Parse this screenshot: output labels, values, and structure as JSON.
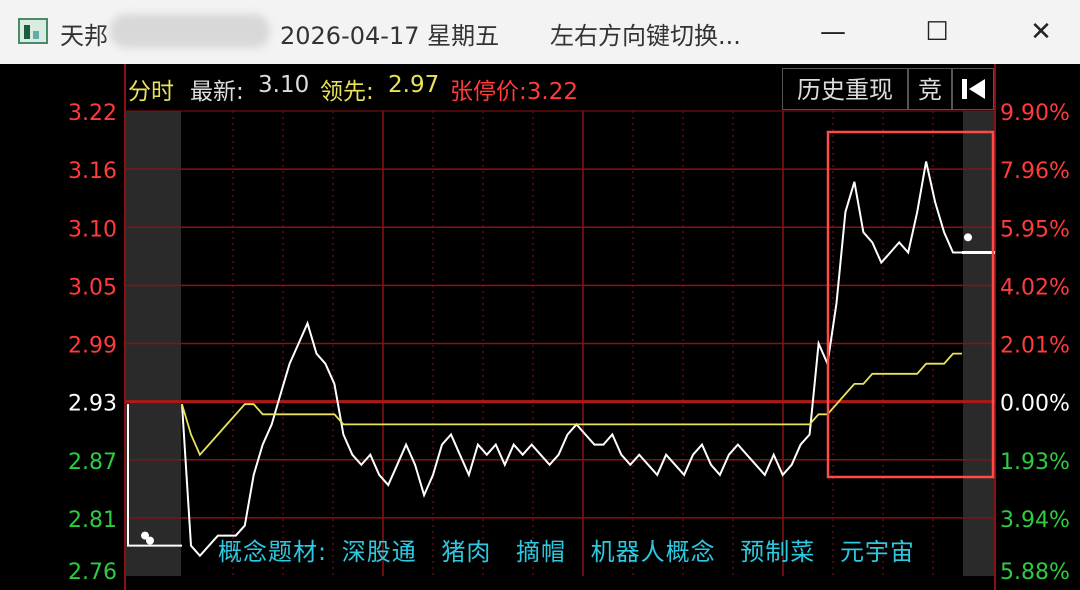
{
  "window": {
    "app_name": "天邦",
    "date": "2026-04-17 星期五",
    "hint": "左右方向键切换...",
    "minimize_glyph": "—",
    "maximize_glyph": "☐",
    "close_glyph": "✕"
  },
  "header": {
    "mode": "分时",
    "latest_label": "最新:",
    "latest_value": "3.10",
    "lead_label": "领先:",
    "lead_value": "2.97",
    "limit_label": "张停价:3.22",
    "history_button": "历史重现",
    "auction_button": "竞",
    "back_icon": "step-back-icon"
  },
  "axes": {
    "left_ticks": [
      "3.22",
      "3.16",
      "3.10",
      "3.05",
      "2.99",
      "2.93",
      "2.87",
      "2.81",
      "2.76"
    ],
    "right_ticks": [
      "9.90%",
      "7.96%",
      "5.95%",
      "4.02%",
      "2.01%",
      "0.00%",
      "1.93%",
      "3.94%",
      "5.88%"
    ]
  },
  "concepts": {
    "label": "概念题材:",
    "items": [
      "深股通",
      "猪肉",
      "摘帽",
      "机器人概念",
      "预制菜",
      "元宇宙"
    ]
  },
  "colors": {
    "price_line": "#ffffff",
    "avg_line": "#e8e35a",
    "up": "#ff3b3b",
    "down": "#2ecc40",
    "grid": "#8b1010",
    "highlight_box": "#ff4a4a",
    "concept_text": "#2ec8e0"
  },
  "chart_data": {
    "type": "line",
    "ylim": [
      2.76,
      3.22
    ],
    "prev_close": 2.93,
    "series": [
      {
        "values": [
          2.93,
          2.79,
          2.78,
          2.79,
          2.8,
          2.8,
          2.8,
          2.81,
          2.86,
          2.89,
          2.91,
          2.94,
          2.97,
          2.99,
          3.01,
          2.98,
          2.97,
          2.95,
          2.9,
          2.88,
          2.87,
          2.88,
          2.86,
          2.85,
          2.87,
          2.89,
          2.87,
          2.84,
          2.86,
          2.89,
          2.9,
          2.88,
          2.86,
          2.89,
          2.88,
          2.89,
          2.87,
          2.89,
          2.88,
          2.89,
          2.88,
          2.87,
          2.88,
          2.9,
          2.91,
          2.9,
          2.89,
          2.89,
          2.9,
          2.88,
          2.87,
          2.88,
          2.87,
          2.86,
          2.88,
          2.87,
          2.86,
          2.88,
          2.89,
          2.87,
          2.86,
          2.88,
          2.89,
          2.88,
          2.87,
          2.86,
          2.88,
          2.86,
          2.87,
          2.89,
          2.9,
          2.99,
          2.97,
          3.03,
          3.12,
          3.15,
          3.1,
          3.09,
          3.07,
          3.08,
          3.09,
          3.08,
          3.12,
          3.17,
          3.13,
          3.1,
          3.08,
          3.08
        ]
      },
      {
        "values": [
          2.93,
          2.9,
          2.88,
          2.89,
          2.9,
          2.91,
          2.92,
          2.93,
          2.93,
          2.92,
          2.92,
          2.92,
          2.92,
          2.92,
          2.92,
          2.92,
          2.92,
          2.92,
          2.91,
          2.91,
          2.91,
          2.91,
          2.91,
          2.91,
          2.91,
          2.91,
          2.91,
          2.91,
          2.91,
          2.91,
          2.91,
          2.91,
          2.91,
          2.91,
          2.91,
          2.91,
          2.91,
          2.91,
          2.91,
          2.91,
          2.91,
          2.91,
          2.91,
          2.91,
          2.91,
          2.91,
          2.91,
          2.91,
          2.91,
          2.91,
          2.91,
          2.91,
          2.91,
          2.91,
          2.91,
          2.91,
          2.91,
          2.91,
          2.91,
          2.91,
          2.91,
          2.91,
          2.91,
          2.91,
          2.91,
          2.91,
          2.91,
          2.91,
          2.91,
          2.91,
          2.91,
          2.92,
          2.92,
          2.93,
          2.94,
          2.95,
          2.95,
          2.96,
          2.96,
          2.96,
          2.96,
          2.96,
          2.96,
          2.97,
          2.97,
          2.97,
          2.98,
          2.98
        ]
      }
    ]
  }
}
